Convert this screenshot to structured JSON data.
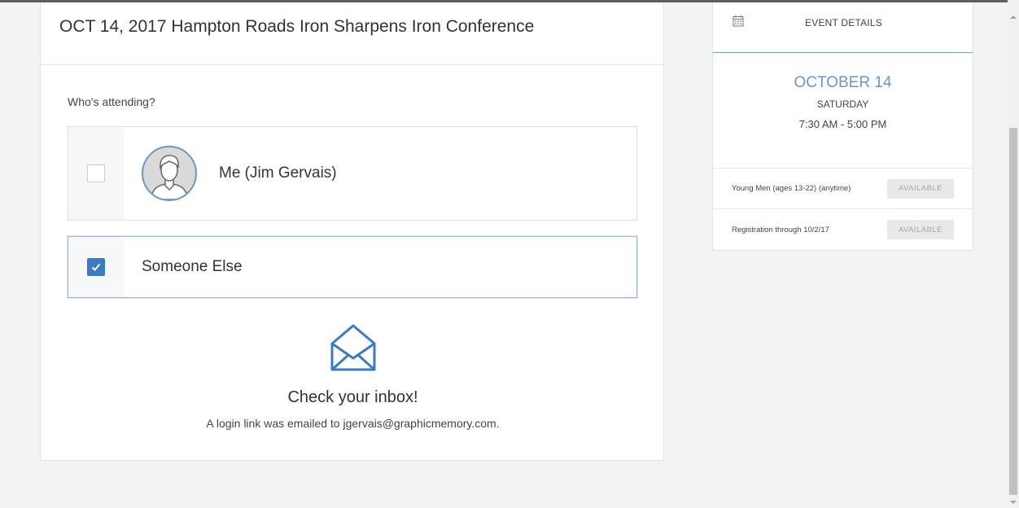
{
  "main": {
    "title": "OCT 14, 2017 Hampton Roads Iron Sharpens Iron Conference",
    "attending_label": "Who's attending?",
    "options": [
      {
        "label": "Me (Jim Gervais)",
        "checked": false
      },
      {
        "label": "Someone Else",
        "checked": true
      }
    ],
    "inbox": {
      "icon": "envelope-open-icon",
      "title": "Check your inbox!",
      "message": "A login link was emailed to jgervais@graphicmemory.com."
    }
  },
  "side": {
    "header_icon": "calendar-icon",
    "header_title": "EVENT DETAILS",
    "date": "OCTOBER 14",
    "day": "SATURDAY",
    "time": "7:30 AM - 5:00 PM",
    "tickets": [
      {
        "name": "Young Men (ages 13-22) (anytime)",
        "status": "AVAILABLE"
      },
      {
        "name": "Registration through 10/2/17",
        "status": "AVAILABLE"
      }
    ]
  },
  "colors": {
    "accent": "#3b7bc4",
    "date_blue": "#6b96c8",
    "background": "#f2f3f5"
  }
}
